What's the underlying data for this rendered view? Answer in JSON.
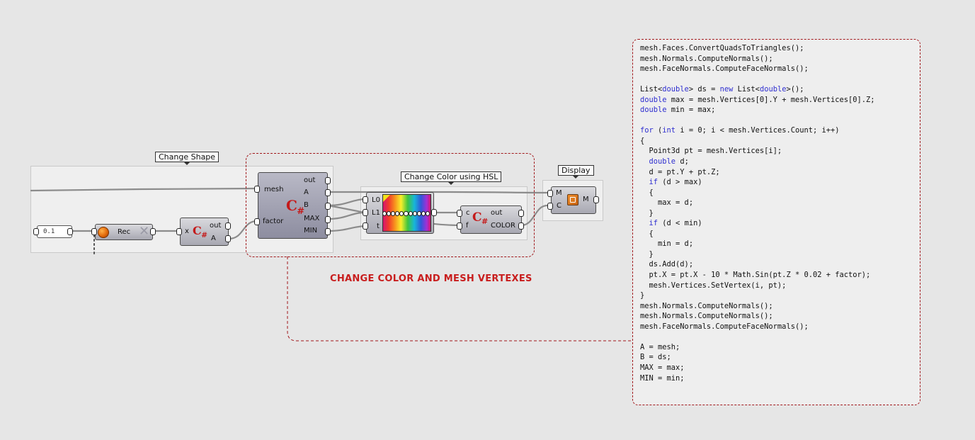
{
  "groups": {
    "change_shape": "Change Shape",
    "change_color": "Change Color using HSL",
    "display": "Display"
  },
  "annotation": "CHANGE COLOR AND MESH VERTEXES",
  "slider_value": "0.1",
  "record": {
    "label": "Rec"
  },
  "script_small": {
    "input": "x",
    "outputs": [
      "out",
      "A"
    ]
  },
  "script_big": {
    "inputs": [
      "mesh",
      "factor"
    ],
    "outputs": [
      "out",
      "A",
      "B",
      "MAX",
      "MIN"
    ]
  },
  "gradient": {
    "inputs": [
      "L0",
      "L1",
      "t"
    ]
  },
  "script_color": {
    "inputs": [
      "c",
      "f"
    ],
    "outputs": [
      "out",
      "COLOR"
    ]
  },
  "display_comp": {
    "inputs": [
      "M",
      "C"
    ],
    "output": "M"
  },
  "icons": [
    "csharp-script-icon",
    "record-icon",
    "clear-x-icon",
    "gradient-icon",
    "mesh-preview-icon"
  ],
  "colors": {
    "annotation_red": "#c81e1e",
    "dash_border": "#a1171b",
    "keyword_blue": "#2f2fd0"
  },
  "code": [
    "mesh.Faces.ConvertQuadsToTriangles();",
    "mesh.Normals.ComputeNormals();",
    "mesh.FaceNormals.ComputeFaceNormals();",
    "",
    "List<double> ds = new List<double>();",
    "double max = mesh.Vertices[0].Y + mesh.Vertices[0].Z;",
    "double min = max;",
    "",
    "for (int i = 0; i < mesh.Vertices.Count; i++)",
    "{",
    "  Point3d pt = mesh.Vertices[i];",
    "  double d;",
    "  d = pt.Y + pt.Z;",
    "  if (d > max)",
    "  {",
    "    max = d;",
    "  }",
    "  if (d < min)",
    "  {",
    "    min = d;",
    "  }",
    "  ds.Add(d);",
    "  pt.X = pt.X - 10 * Math.Sin(pt.Z * 0.02 + factor);",
    "  mesh.Vertices.SetVertex(i, pt);",
    "}",
    "mesh.Normals.ComputeNormals();",
    "mesh.Normals.ComputeNormals();",
    "mesh.FaceNormals.ComputeFaceNormals();",
    "",
    "A = mesh;",
    "B = ds;",
    "MAX = max;",
    "MIN = min;"
  ]
}
